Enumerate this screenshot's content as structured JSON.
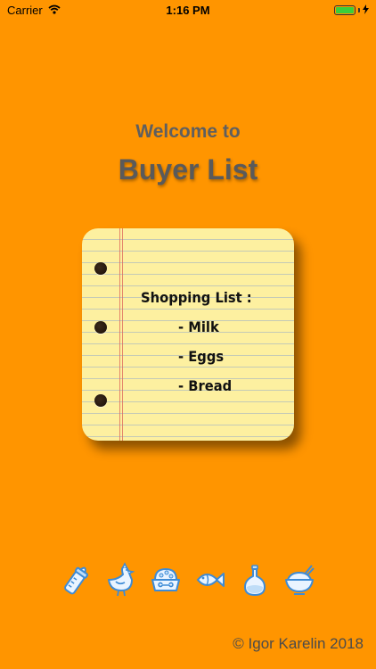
{
  "status_bar": {
    "carrier": "Carrier",
    "time": "1:16 PM",
    "battery_level": 1.0,
    "wifi_icon": "wifi-icon",
    "charging_icon": "bolt-icon"
  },
  "header": {
    "welcome": "Welcome to",
    "app_name": "Buyer List"
  },
  "notepad": {
    "title": "Shopping List :",
    "items": [
      "- Milk",
      "- Eggs",
      "- Bread"
    ]
  },
  "icons": [
    "baby-bottle-icon",
    "chicken-icon",
    "pet-food-bowl-icon",
    "fish-icon",
    "oil-bottle-icon",
    "rice-bowl-icon"
  ],
  "footer": {
    "copyright": "© Igor Karelin 2018"
  },
  "colors": {
    "background": "#FF9500",
    "notepad": "#FDF0A0",
    "title_text": "#5a5a5a",
    "icon_fill": "#EAF4FF",
    "icon_stroke": "#3D8BD6"
  }
}
